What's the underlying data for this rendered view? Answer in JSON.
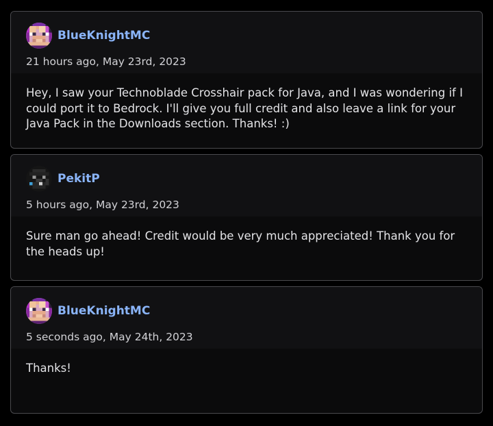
{
  "comments": [
    {
      "author": "BlueKnightMC",
      "avatar_icon": "pixel-avatar-icon",
      "timestamp": "21 hours ago, May 23rd, 2023",
      "body": "Hey, I saw your Technoblade Crosshair pack for Java, and I was wondering if I could port it to Bedrock. I'll give you full credit and also leave a link for your Java Pack in the Downloads section. Thanks! :)"
    },
    {
      "author": "PekitP",
      "avatar_icon": "dark-avatar-icon",
      "timestamp": "5 hours ago, May 23rd, 2023",
      "body": "Sure man go ahead! Credit would be very much appreciated! Thank you for the heads up!"
    },
    {
      "author": "BlueKnightMC",
      "avatar_icon": "pixel-avatar-icon",
      "timestamp": "5 seconds ago, May 24th, 2023",
      "body": "Thanks!"
    }
  ],
  "colors": {
    "username": "#8ab4f8",
    "card_border": "#4a4a4e",
    "background": "#000000"
  }
}
